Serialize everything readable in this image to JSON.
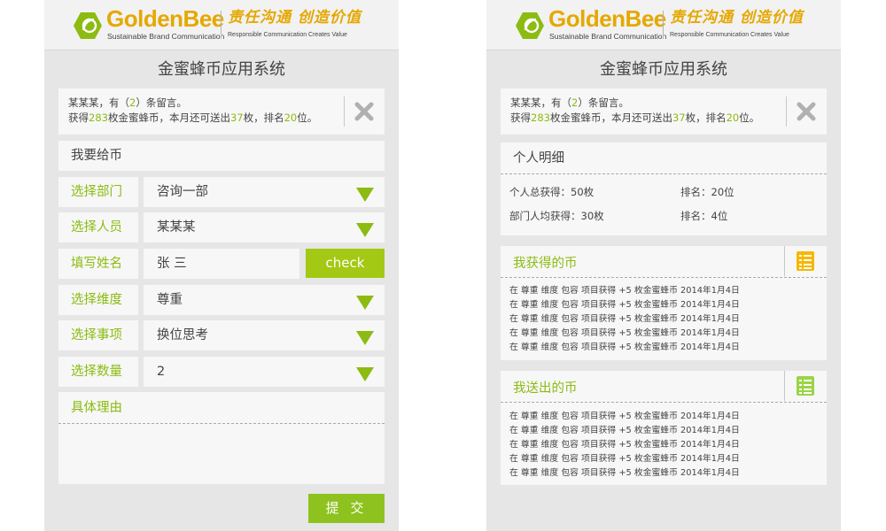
{
  "brand": {
    "name": "GoldenBee",
    "tagline": "Sustainable Brand Communication",
    "slogan": "责任沟通 创造价值",
    "slogan_en": "Responsible  Communication  Creates  Value"
  },
  "app_title": "金蜜蜂币应用系统",
  "message": {
    "line1_prefix": "某某某，有（",
    "count": "2",
    "line1_suffix": "）条留言。",
    "line2_a": "获得",
    "earned": "283",
    "line2_b": "枚金蜜蜂币，本月还可送出",
    "remaining": "37",
    "line2_c": "枚，排名",
    "rank": "20",
    "line2_d": "位。"
  },
  "give_form": {
    "section_title": "我要给币",
    "department_label": "选择部门",
    "department_value": "咨询一部",
    "person_label": "选择人员",
    "person_value": "某某某",
    "name_label": "填写姓名",
    "name_value": "张 三",
    "check_label": "check",
    "dimension_label": "选择维度",
    "dimension_value": "尊重",
    "matter_label": "选择事项",
    "matter_value": "换位思考",
    "quantity_label": "选择数量",
    "quantity_value": "2",
    "reason_label": "具体理由",
    "submit_label": "提 交"
  },
  "detail": {
    "title": "个人明细",
    "total_earned": "个人总获得：50枚",
    "rank": "排名：20位",
    "dept_avg": "部门人均获得：30枚",
    "dept_rank": "排名：4位"
  },
  "received": {
    "title": "我获得的币",
    "records": [
      "在 尊重 维度 包容 项目获得 +5 枚金蜜蜂币 2014年1月4日",
      "在 尊重 维度 包容 项目获得 +5 枚金蜜蜂币 2014年1月4日",
      "在 尊重 维度 包容 项目获得 +5 枚金蜜蜂币 2014年1月4日",
      "在 尊重 维度 包容 项目获得 +5 枚金蜜蜂币 2014年1月4日",
      "在 尊重 维度 包容 项目获得 +5 枚金蜜蜂币 2014年1月4日"
    ]
  },
  "sent": {
    "title": "我送出的币",
    "records": [
      "在 尊重 维度 包容 项目获得 +5 枚金蜜蜂币 2014年1月4日",
      "在 尊重 维度 包容 项目获得 +5 枚金蜜蜂币 2014年1月4日",
      "在 尊重 维度 包容 项目获得 +5 枚金蜜蜂币 2014年1月4日",
      "在 尊重 维度 包容 项目获得 +5 枚金蜜蜂币 2014年1月4日",
      "在 尊重 维度 包容 项目获得 +5 枚金蜜蜂币 2014年1月4日"
    ]
  },
  "colors": {
    "accent_green": "#8cbb12",
    "brand_gold": "#e5a800",
    "received_icon": "#f5b800",
    "sent_icon": "#9bd448"
  },
  "icons": {
    "logo": "hexagon-bee-logo-icon",
    "close": "close-x-icon",
    "dropdown": "triangle-down-icon",
    "list": "list-icon"
  }
}
